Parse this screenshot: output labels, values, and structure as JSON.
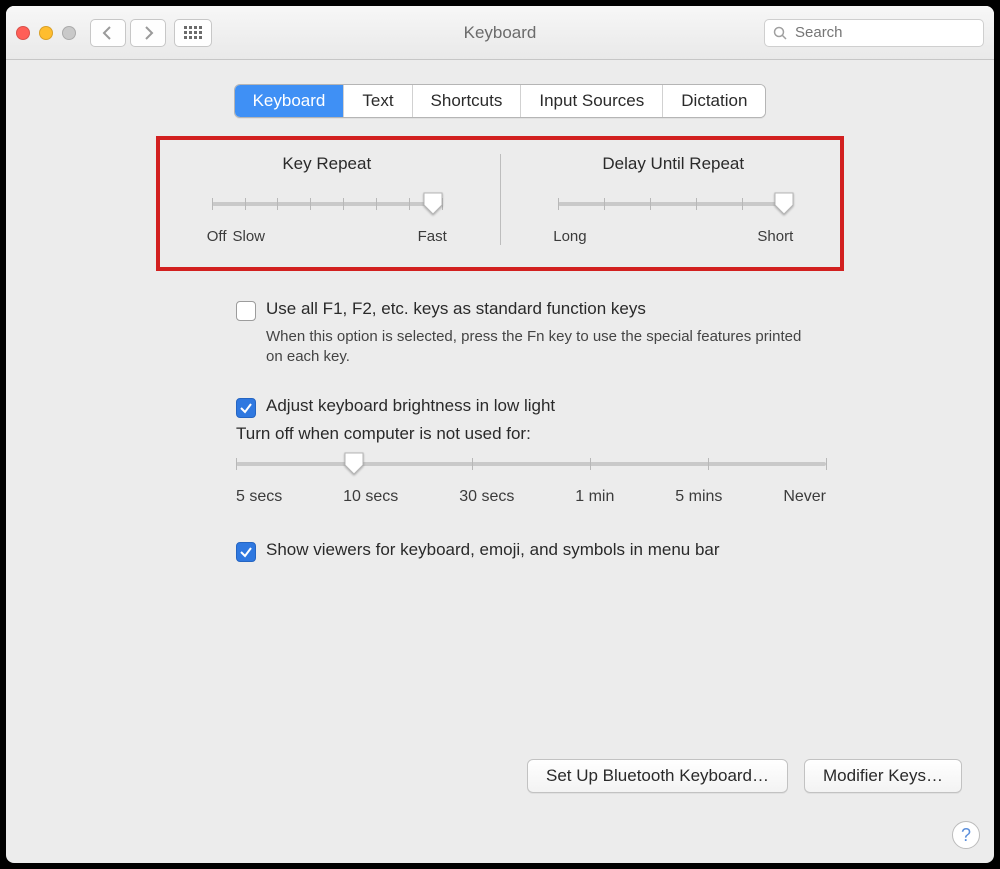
{
  "window": {
    "title": "Keyboard"
  },
  "search": {
    "placeholder": "Search"
  },
  "tabs": {
    "items": [
      {
        "label": "Keyboard",
        "active": true
      },
      {
        "label": "Text"
      },
      {
        "label": "Shortcuts"
      },
      {
        "label": "Input Sources"
      },
      {
        "label": "Dictation"
      }
    ]
  },
  "keyRepeat": {
    "title": "Key Repeat",
    "leftLabel": "Off",
    "secondLabel": "Slow",
    "rightLabel": "Fast",
    "positionPercent": 96,
    "tickCount": 8
  },
  "delayRepeat": {
    "title": "Delay Until Repeat",
    "leftLabel": "Long",
    "rightLabel": "Short",
    "positionPercent": 98,
    "tickCount": 6
  },
  "fnKeys": {
    "label": "Use all F1, F2, etc. keys as standard function keys",
    "help": "When this option is selected, press the Fn key to use the special features printed on each key.",
    "checked": false
  },
  "brightness": {
    "label": "Adjust keyboard brightness in low light",
    "checked": true
  },
  "backlight": {
    "prompt": "Turn off when computer is not used for:",
    "labels": [
      "5 secs",
      "10 secs",
      "30 secs",
      "1 min",
      "5 mins",
      "Never"
    ],
    "positionPercent": 20
  },
  "showViewers": {
    "label": "Show viewers for keyboard, emoji, and symbols in menu bar",
    "checked": true
  },
  "buttons": {
    "bluetooth": "Set Up Bluetooth Keyboard…",
    "modifier": "Modifier Keys…"
  },
  "helpTooltip": "?"
}
